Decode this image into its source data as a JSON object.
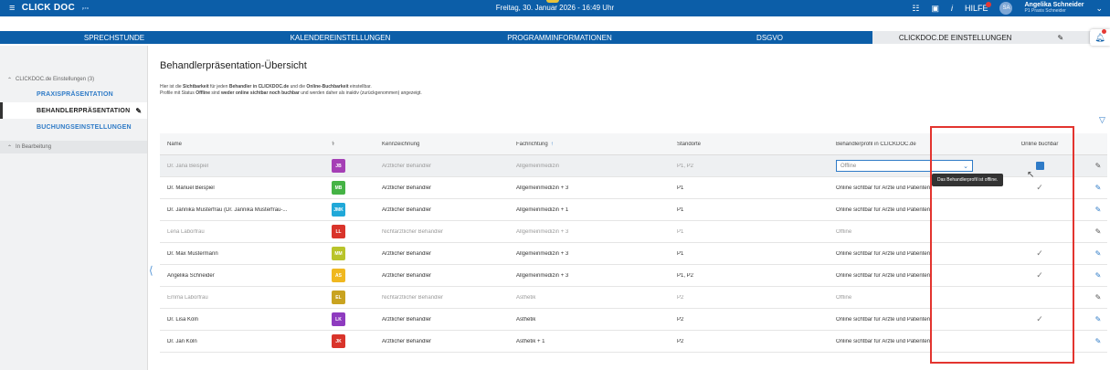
{
  "header": {
    "logo": "CLICK DOC",
    "logo_sup": "pro",
    "datetime": "Freitag, 30. Januar 2026 - 16:49 Uhr",
    "help_label": "HILFE",
    "user_initials": "SA",
    "user_name": "Angelika Schneider",
    "user_practice": "P1 Praxis Schneider"
  },
  "tabs": [
    {
      "label": "SPRECHSTUNDE"
    },
    {
      "label": "KALENDEREINSTELLUNGEN"
    },
    {
      "label": "PROGRAMMINFORMATIONEN"
    },
    {
      "label": "DSGVO"
    },
    {
      "label": "CLICKDOC.DE EINSTELLUNGEN"
    }
  ],
  "sidebar": {
    "group1": "CLICKDOC.de Einstellungen (3)",
    "items": [
      {
        "label": "PRAXISPRÄSENTATION"
      },
      {
        "label": "BEHANDLERPRÄSENTATION"
      },
      {
        "label": "BUCHUNGSEINSTELLUNGEN"
      }
    ],
    "group2": "In Bearbeitung"
  },
  "main": {
    "title": "Behandlerpräsentation-Übersicht",
    "desc1_a": "Hier ist die ",
    "desc1_b": "Sichtbarkeit",
    "desc1_c": " für jeden ",
    "desc1_d": "Behandler in CLICKDOC.de",
    "desc1_e": " und die ",
    "desc1_f": "Online-Buchbarkeit",
    "desc1_g": " einstellbar.",
    "desc2_a": "Profile mit Status ",
    "desc2_b": "Offline",
    "desc2_c": " sind ",
    "desc2_d": "weder online sichtbar noch buchbar",
    "desc2_e": " und werden daher als inaktiv (zurückgenommen) angezeigt."
  },
  "table": {
    "headers": {
      "name": "Name",
      "kennzeichnung": "Kennzeichnung",
      "fachrichtung": "Fachrichtung",
      "standorte": "Standorte",
      "profil": "Behandlerprofil in CLICKDOC.de",
      "buchbar": "Online buchbar"
    },
    "tooltip": "Das Behandlerprofil ist offline.",
    "select_value": "Offline",
    "rows": [
      {
        "name": "Dr. Jana Beispiel",
        "initials": "JB",
        "color": "#a53fb5",
        "kz": "Ärztlicher Behandler",
        "fr": "Allgemeinmedizin",
        "st": "P1, P2",
        "profil": "Offline",
        "check": ""
      },
      {
        "name": "Dr. Manuel Beispiel",
        "initials": "MB",
        "color": "#45b345",
        "kz": "Ärztlicher Behandler",
        "fr": "Allgemeinmedizin  + 3",
        "st": "P1",
        "profil": "Online sichtbar für Ärzte und Patienten",
        "check": "✓"
      },
      {
        "name": "Dr. Jannika Musterfrau (Dr. Jannika Musterfrau-...",
        "initials": "JMK",
        "color": "#20a8d8",
        "kz": "Ärztlicher Behandler",
        "fr": "Allgemeinmedizin  + 1",
        "st": "P1",
        "profil": "Online sichtbar für Ärzte und Patienten",
        "check": ""
      },
      {
        "name": "Lena Laborfrau",
        "initials": "LL",
        "color": "#d9342b",
        "kz": "Nichtärztlicher Behandler",
        "fr": "Allgemeinmedizin  + 3",
        "st": "P1",
        "profil": "Offline",
        "check": ""
      },
      {
        "name": "Dr. Max Mustermann",
        "initials": "MM",
        "color": "#b9c42a",
        "kz": "Ärztlicher Behandler",
        "fr": "Allgemeinmedizin  + 3",
        "st": "P1",
        "profil": "Online sichtbar für Ärzte und Patienten",
        "check": "✓"
      },
      {
        "name": "Angelika Schneider",
        "initials": "AS",
        "color": "#f0b820",
        "kz": "Ärztlicher Behandler",
        "fr": "Allgemeinmedizin  + 3",
        "st": "P1, P2",
        "profil": "Online sichtbar für Ärzte und Patienten",
        "check": "✓"
      },
      {
        "name": "Emma Laborfrau",
        "initials": "EL",
        "color": "#c9a320",
        "kz": "Nichtärztlicher Behandler",
        "fr": "Ästhetik",
        "st": "P2",
        "profil": "Offline",
        "check": ""
      },
      {
        "name": "Dr. Lisa Köln",
        "initials": "LK",
        "color": "#8e3bbf",
        "kz": "Ärztlicher Behandler",
        "fr": "Ästhetik",
        "st": "P2",
        "profil": "Online sichtbar für Ärzte und Patienten",
        "check": "✓"
      },
      {
        "name": "Dr. Jan Köln",
        "initials": "JK",
        "color": "#d9342b",
        "kz": "Ärztlicher Behandler",
        "fr": "Ästhetik  + 1",
        "st": "P2",
        "profil": "Online sichtbar für Ärzte und Patienten",
        "check": ""
      }
    ]
  }
}
